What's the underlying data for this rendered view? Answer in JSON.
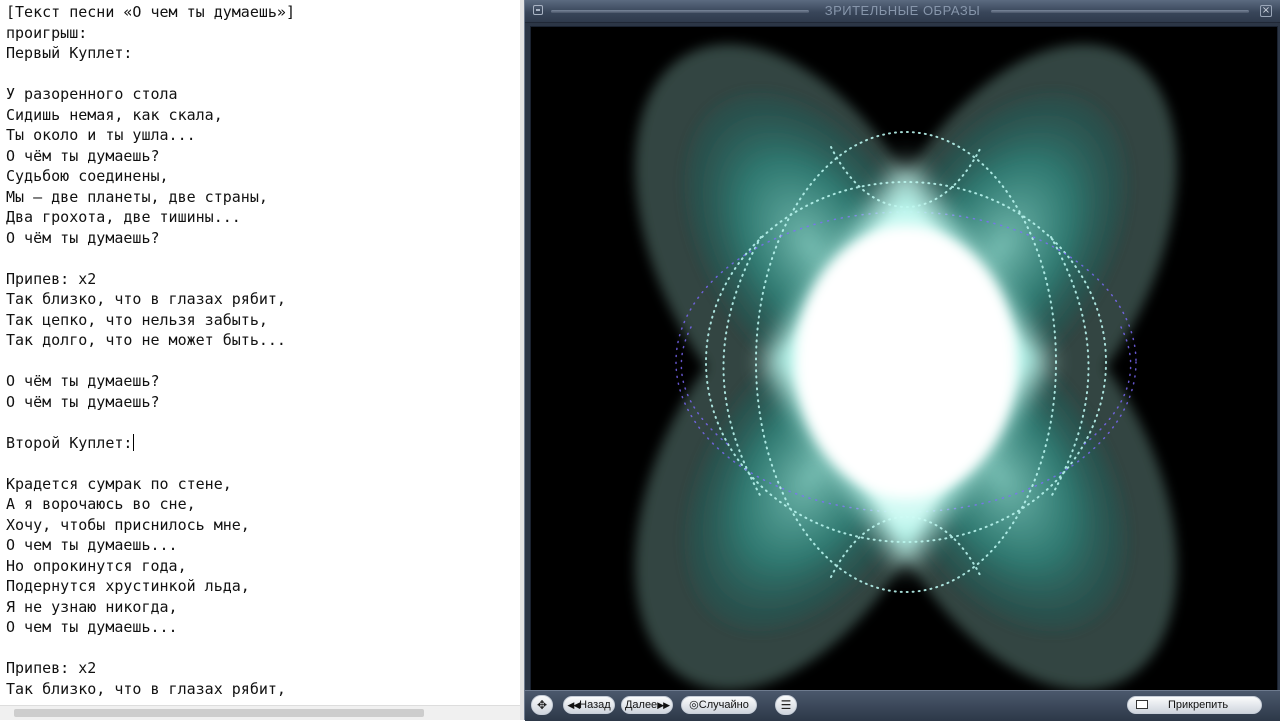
{
  "editor": {
    "lines": [
      "[Текст песни «О чем ты думаешь»]",
      "проигрыш:",
      "Первый Куплет:",
      "",
      "У разоренного стола",
      "Сидишь немая, как скала,",
      "Ты около и ты ушла...",
      "О чём ты думаешь?",
      "Судьбою соединены,",
      "Мы – две планеты, две страны,",
      "Два грохота, две тишины...",
      "О чём ты думаешь?",
      "",
      "Припев: х2",
      "Так близко, что в глазах рябит,",
      "Так цепко, что нельзя забыть,",
      "Так долго, что не может быть...",
      "",
      "О чём ты думаешь?",
      "О чём ты думаешь?",
      "",
      "Второй Куплет:",
      "",
      "Крадется сумрак по стене,",
      "А я ворочаюсь во сне,",
      "Хочу, чтобы приснилось мне,",
      "О чем ты думаешь...",
      "Но опрокинутся года,",
      "Подернутся хрустинкой льда,",
      "Я не узнаю никогда,",
      "О чем ты думаешь...",
      "",
      "Припев: х2",
      "Так близко, что в глазах рябит,"
    ],
    "caret_line": 21
  },
  "player": {
    "title": "ЗРИТЕЛЬНЫЕ ОБРАЗЫ",
    "controls": {
      "back_label": "Назад",
      "next_label": "Далее",
      "random_label": "Случайно",
      "pin_label": "Прикрепить"
    },
    "icons": {
      "window": "window-grip-icon",
      "close": "close-icon",
      "move": "move-arrows-icon",
      "back": "double-left-arrow-icon",
      "next": "double-right-arrow-icon",
      "random": "random-icon",
      "menu": "list-menu-icon",
      "pin": "pin-window-icon"
    },
    "colors": {
      "chrome": "#2c3646",
      "glow": "#ffffff",
      "teal": "#3ec9b5",
      "background": "#000000"
    }
  }
}
